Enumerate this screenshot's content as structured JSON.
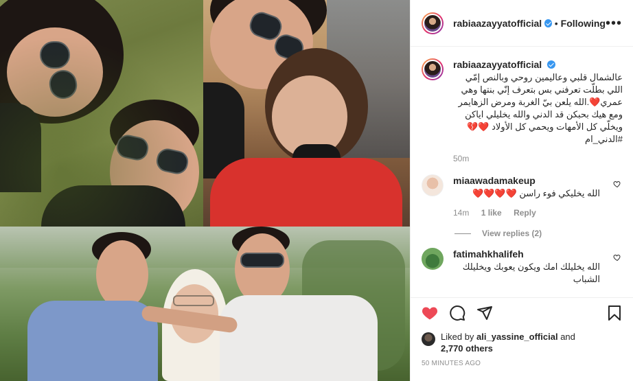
{
  "post": {
    "author": "rabiaazayyatofficial",
    "verified": true,
    "separator": "•",
    "follow_status": "Following",
    "more_label": "•••",
    "images": [
      "collage-photo-couple-grass",
      "collage-photo-couple-portrait",
      "collage-photo-family-garden"
    ]
  },
  "caption": {
    "author": "rabiaazayyatofficial",
    "text": "عالشمال قلبي وعاليمين روحي وبالنص إمّي اللي بطلّت تعرفني بس بتعرف إنّي بنتها وهي عمري❤️.الله يلعن بيّ الغربة ومرض الزهايمر ومع هيك بحبكن قد الدني والله يخليلي اياكن ويخلّي كل الأمهات ويحمي كل الأولاد ❤️💔 #الدني_ام",
    "time": "50m"
  },
  "comments": [
    {
      "user": "miaawadamakeup",
      "text": "الله يخليكي فوء راسن ❤️❤️❤️❤️",
      "time": "14m",
      "likes": "1 like",
      "reply": "Reply"
    },
    {
      "user": "fatimahkhalifeh",
      "text": "الله يخليلك امك ويكون يعوبك ويخليلك الشباب"
    }
  ],
  "view_replies": "View replies (2)",
  "likes": {
    "prefix": "Liked by",
    "user": "ali_yassine_official",
    "and": "and",
    "count": "2,770 others"
  },
  "timestamp": "50 MINUTES AGO",
  "colors": {
    "heart": "#ed4956",
    "link": "#262626",
    "muted": "#8e8e8e",
    "verified": "#3897f0"
  }
}
